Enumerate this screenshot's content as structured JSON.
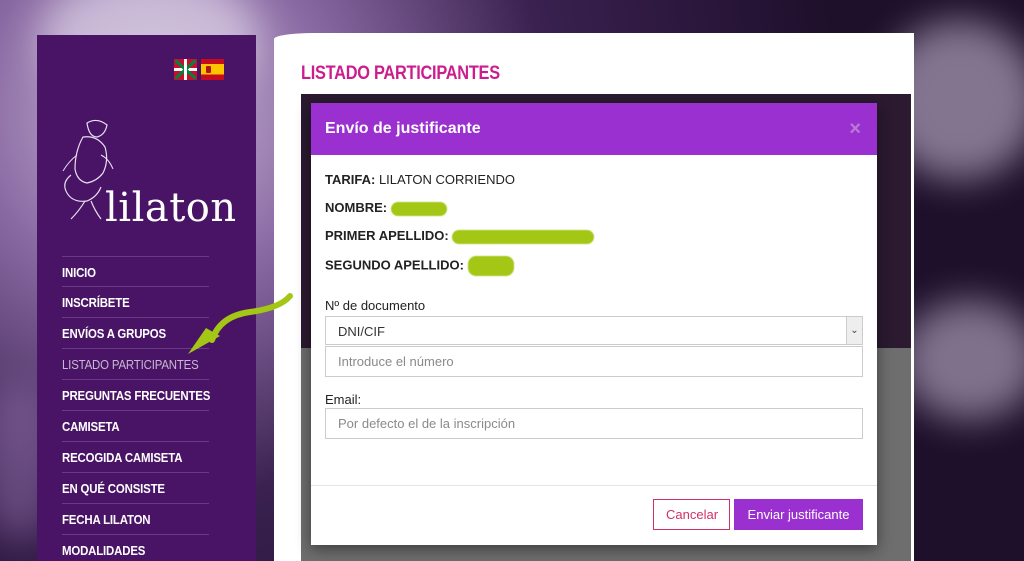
{
  "site": {
    "logo_text": "lilaton",
    "nav": [
      {
        "label": "INICIO",
        "active": false
      },
      {
        "label": "INSCRÍBETE",
        "active": false
      },
      {
        "label": "ENVÍOS A GRUPOS",
        "active": false
      },
      {
        "label": "LISTADO PARTICIPANTES",
        "active": true
      },
      {
        "label": "PREGUNTAS FRECUENTES",
        "active": false
      },
      {
        "label": "CAMISETA",
        "active": false
      },
      {
        "label": "RECOGIDA CAMISETA",
        "active": false
      },
      {
        "label": "EN QUÉ CONSISTE",
        "active": false
      },
      {
        "label": "FECHA LILATON",
        "active": false
      },
      {
        "label": "MODALIDADES",
        "active": false
      }
    ],
    "flags": [
      "basque-flag-icon",
      "spain-flag-icon"
    ]
  },
  "main": {
    "page_title": "LISTADO PARTICIPANTES"
  },
  "modal": {
    "title": "Envío de justificante",
    "close_label": "×",
    "tarifa_label": "TARIFA:",
    "tarifa_value": "LILATON CORRIENDO",
    "nombre_label": "NOMBRE:",
    "primer_apellido_label": "PRIMER APELLIDO:",
    "segundo_apellido_label": "SEGUNDO APELLIDO:",
    "doc_label": "Nº de documento",
    "doc_type_selected": "DNI/CIF",
    "doc_number_placeholder": "Introduce el número",
    "email_label": "Email:",
    "email_placeholder": "Por defecto el de la inscripción",
    "cancel_label": "Cancelar",
    "send_label": "Enviar justificante"
  },
  "colors": {
    "sidebar": "#4a1466",
    "modal_header": "#9b30d0",
    "title_pink": "#cc1d8e",
    "arrow": "#a4c715"
  }
}
